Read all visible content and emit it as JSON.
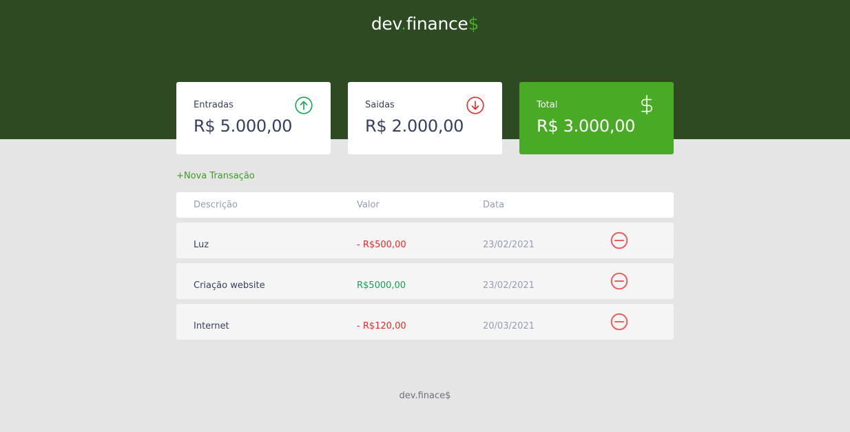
{
  "header": {
    "logo_main": "dev",
    "logo_dot": ".",
    "logo_rest": "finance",
    "logo_dollar": "$"
  },
  "cards": {
    "income": {
      "label": "Entradas",
      "value": "R$ 5.000,00",
      "icon": "arrow-up-circle-icon"
    },
    "expense": {
      "label": "Saidas",
      "value": "R$ 2.000,00",
      "icon": "arrow-down-circle-icon"
    },
    "total": {
      "label": "Total",
      "value": "R$ 3.000,00",
      "icon": "dollar-sign-icon"
    }
  },
  "actions": {
    "new_transaction": "+Nova Transação"
  },
  "table": {
    "headers": [
      "Descrição",
      "Valor",
      "Data"
    ],
    "rows": [
      {
        "description": "Luz",
        "amount": "- R$500,00",
        "type": "expense",
        "date": "23/02/2021"
      },
      {
        "description": "Criação website",
        "amount": "R$5000,00",
        "type": "income",
        "date": "23/02/2021"
      },
      {
        "description": "Internet",
        "amount": "- R$120,00",
        "type": "expense",
        "date": "20/03/2021"
      }
    ]
  },
  "footer": {
    "text": "dev.finace$"
  },
  "colors": {
    "header_bg": "#2d4a22",
    "accent_green": "#49aa26",
    "income": "#12a454",
    "expense": "#e92929",
    "page_bg": "#e5e5e5"
  }
}
